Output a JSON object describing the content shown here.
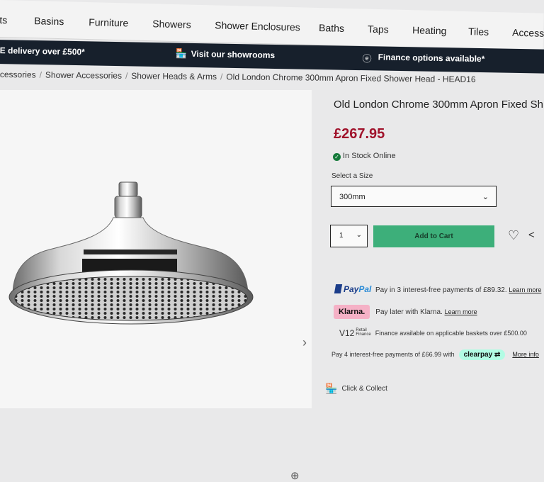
{
  "nav": {
    "items": [
      "ts",
      "Basins",
      "Furniture",
      "Showers",
      "Shower Enclosures",
      "Baths",
      "Taps",
      "Heating",
      "Tiles",
      "Accesso"
    ]
  },
  "promo": {
    "delivery": "E delivery over £500*",
    "showrooms": "Visit our showrooms",
    "finance": "Finance options available*",
    "showrooms_icon": "store-icon",
    "finance_icon": "pound-circle-icon"
  },
  "breadcrumb": {
    "items": [
      "cessories",
      "Shower Accessories",
      "Shower Heads & Arms",
      "Old London Chrome 300mm Apron Fixed Shower Head - HEAD16"
    ],
    "separator": "/"
  },
  "product": {
    "title": "Old London Chrome 300mm Apron Fixed Sh",
    "price": "£267.95",
    "price_color": "#a0122b",
    "stock": "In Stock Online",
    "stock_color": "#157a3a",
    "size_label": "Select a Size",
    "size_value": "300mm",
    "quantity": "1",
    "add_to_cart": "Add to Cart",
    "cart_color": "#3daf7a"
  },
  "payments": {
    "paypal_brand_a": "Pay",
    "paypal_brand_b": "Pal",
    "paypal_text": "Pay in 3 interest-free payments of £89.32.",
    "paypal_link": "Learn more",
    "klarna_brand": "Klarna.",
    "klarna_text": "Pay later with Klarna.",
    "klarna_link": "Learn more",
    "v12_brand": "V12",
    "v12_sub_a": "Retail",
    "v12_sub_b": "Finance",
    "v12_text": "Finance available on applicable baskets over £500.00",
    "clearpay_text": "Pay 4 interest-free payments of £66.99 with",
    "clearpay_brand": "clearpay",
    "clearpay_link": "More info"
  },
  "fulfilment": {
    "collect": "Click & Collect"
  }
}
